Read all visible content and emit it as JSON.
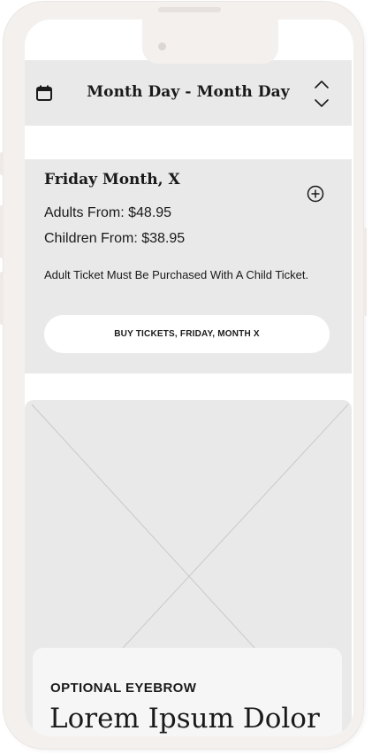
{
  "date_selector": {
    "range_label": "Month Day - Month Day",
    "icons": {
      "calendar": "calendar-icon",
      "up": "chevron-up-icon",
      "down": "chevron-down-icon"
    }
  },
  "day_card": {
    "title": "Friday Month, X",
    "adult_price": "Adults From: $48.95",
    "child_price": "Children From: $38.95",
    "note": "Adult Ticket Must Be Purchased With A Child Ticket.",
    "buy_button_label": "BUY TICKETS, FRIDAY, MONTH X",
    "expand_icon": "plus-circle-icon"
  },
  "content_card": {
    "eyebrow": "OPTIONAL EYEBROW",
    "headline": "Lorem Ipsum Dolor"
  },
  "colors": {
    "panel": "#e9e9e9",
    "phone_frame": "#f4f0ee",
    "text": "#1a1a1a"
  }
}
